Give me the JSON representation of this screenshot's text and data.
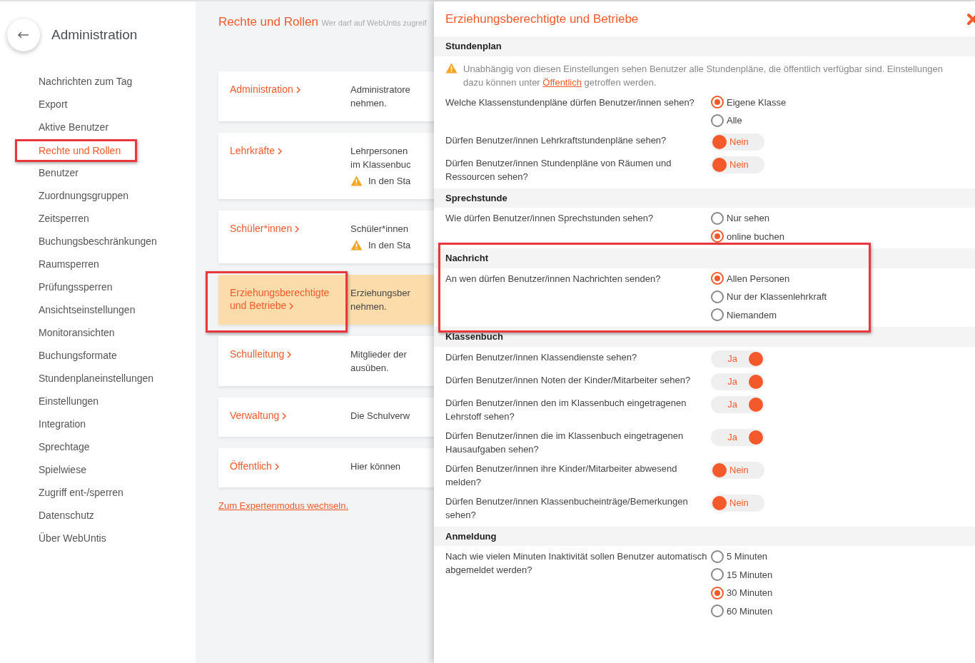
{
  "sidebar": {
    "title": "Administration",
    "items": [
      {
        "label": "Nachrichten zum Tag",
        "selected": false,
        "highlighted": false
      },
      {
        "label": "Export",
        "selected": false,
        "highlighted": false
      },
      {
        "label": "Aktive Benutzer",
        "selected": false,
        "highlighted": false
      },
      {
        "label": "Rechte und Rollen",
        "selected": true,
        "highlighted": true
      },
      {
        "label": "Benutzer",
        "selected": false,
        "highlighted": false
      },
      {
        "label": "Zuordnungsgruppen",
        "selected": false,
        "highlighted": false
      },
      {
        "label": "Zeitsperren",
        "selected": false,
        "highlighted": false
      },
      {
        "label": "Buchungsbeschränkungen",
        "selected": false,
        "highlighted": false
      },
      {
        "label": "Raumsperren",
        "selected": false,
        "highlighted": false
      },
      {
        "label": "Prüfungssperren",
        "selected": false,
        "highlighted": false
      },
      {
        "label": "Ansichtseinstellungen",
        "selected": false,
        "highlighted": false
      },
      {
        "label": "Monitoransichten",
        "selected": false,
        "highlighted": false
      },
      {
        "label": "Buchungsformate",
        "selected": false,
        "highlighted": false
      },
      {
        "label": "Stundenplaneinstellungen",
        "selected": false,
        "highlighted": false
      },
      {
        "label": "Einstellungen",
        "selected": false,
        "highlighted": false
      },
      {
        "label": "Integration",
        "selected": false,
        "highlighted": false
      },
      {
        "label": "Sprechtage",
        "selected": false,
        "highlighted": false
      },
      {
        "label": "Spielwiese",
        "selected": false,
        "highlighted": false
      },
      {
        "label": "Zugriff ent-/sperren",
        "selected": false,
        "highlighted": false
      },
      {
        "label": "Datenschutz",
        "selected": false,
        "highlighted": false
      },
      {
        "label": "Über WebUntis",
        "selected": false,
        "highlighted": false
      }
    ]
  },
  "page": {
    "title": "Rechte und Rollen",
    "subtitle": "Wer darf auf WebUntis zugreif"
  },
  "roles": [
    {
      "name": "Administration",
      "lines": [
        "Administratore",
        "nehmen."
      ],
      "selected": false,
      "highlighted": false
    },
    {
      "name": "Lehrkräfte",
      "lines": [
        "Lehrpersonen",
        "im Klassenbuc"
      ],
      "warning": "In den Sta",
      "selected": false,
      "highlighted": false
    },
    {
      "name": "Schüler*innen",
      "lines": [
        "Schüler*innen"
      ],
      "warning": "In den Sta",
      "selected": false,
      "highlighted": false
    },
    {
      "name": "Erziehungsberechtigte und Betriebe",
      "lines": [
        "Erziehungsber",
        "nehmen."
      ],
      "selected": true,
      "highlighted": true
    },
    {
      "name": "Schulleitung",
      "lines": [
        "Mitglieder der",
        "ausüben."
      ],
      "selected": false,
      "highlighted": false
    },
    {
      "name": "Verwaltung",
      "lines": [
        "Die Schulverw"
      ],
      "selected": false,
      "highlighted": false
    },
    {
      "name": "Öffentlich",
      "lines": [
        "Hier können"
      ],
      "selected": false,
      "highlighted": false
    }
  ],
  "expert_link": "Zum Expertenmodus wechseln.",
  "panel": {
    "title": "Erziehungsberechtigte und Betriebe",
    "sections": [
      {
        "title": "Stundenplan",
        "highlighted": false,
        "notice": {
          "before": "Unabhängig von diesen Einstellungen sehen Benutzer alle Stundenpläne, die öffentlich verfügbar sind. Einstellungen dazu können unter",
          "link": "Öffentlich",
          "after": "getroffen werden."
        },
        "rows": [
          {
            "kind": "radio",
            "question": "Welche Klassenstundenpläne dürfen Benutzer/innen sehen?",
            "options": [
              {
                "label": "Eigene Klasse",
                "selected": true
              },
              {
                "label": "Alle",
                "selected": false
              }
            ]
          },
          {
            "kind": "toggle",
            "question": "Dürfen Benutzer/innen Lehrkraftstundenpläne sehen?",
            "on": false,
            "label": "Nein"
          },
          {
            "kind": "toggle",
            "question": "Dürfen Benutzer/innen Stundenpläne von Räumen und Ressourcen sehen?",
            "on": false,
            "label": "Nein"
          }
        ]
      },
      {
        "title": "Sprechstunde",
        "highlighted": false,
        "rows": [
          {
            "kind": "radio",
            "question": "Wie dürfen Benutzer/innen Sprechstunden sehen?",
            "options": [
              {
                "label": "Nur sehen",
                "selected": false
              },
              {
                "label": "online buchen",
                "selected": true
              }
            ]
          }
        ]
      },
      {
        "title": "Nachricht",
        "highlighted": true,
        "rows": [
          {
            "kind": "radio",
            "question": "An wen dürfen Benutzer/innen Nachrichten senden?",
            "options": [
              {
                "label": "Allen Personen",
                "selected": true
              },
              {
                "label": "Nur der Klassenlehrkraft",
                "selected": false
              },
              {
                "label": "Niemandem",
                "selected": false
              }
            ]
          }
        ]
      },
      {
        "title": "Klassenbuch",
        "highlighted": false,
        "rows": [
          {
            "kind": "toggle",
            "question": "Dürfen Benutzer/innen Klassendienste sehen?",
            "on": true,
            "label": "Ja"
          },
          {
            "kind": "toggle",
            "question": "Dürfen Benutzer/innen Noten der Kinder/Mitarbeiter sehen?",
            "on": true,
            "label": "Ja"
          },
          {
            "kind": "toggle",
            "question": "Dürfen Benutzer/innen den im Klassenbuch eingetragenen Lehrstoff sehen?",
            "on": true,
            "label": "Ja"
          },
          {
            "kind": "toggle",
            "question": "Dürfen Benutzer/innen die im Klassenbuch eingetragenen Hausaufgaben sehen?",
            "on": true,
            "label": "Ja"
          },
          {
            "kind": "toggle",
            "question": "Dürfen Benutzer/innen ihre Kinder/Mitarbeiter abwesend melden?",
            "on": false,
            "label": "Nein"
          },
          {
            "kind": "toggle",
            "question": "Dürfen Benutzer/innen Klassenbucheinträge/Bemerkungen sehen?",
            "on": false,
            "label": "Nein"
          }
        ]
      },
      {
        "title": "Anmeldung",
        "highlighted": false,
        "rows": [
          {
            "kind": "radio",
            "question": "Nach wie vielen Minuten Inaktivität sollen Benutzer automatisch abgemeldet werden?",
            "options": [
              {
                "label": "5 Minuten",
                "selected": false
              },
              {
                "label": "15 Minuten",
                "selected": false
              },
              {
                "label": "30 Minuten",
                "selected": true
              },
              {
                "label": "60 Minuten",
                "selected": false
              }
            ]
          }
        ]
      }
    ]
  }
}
